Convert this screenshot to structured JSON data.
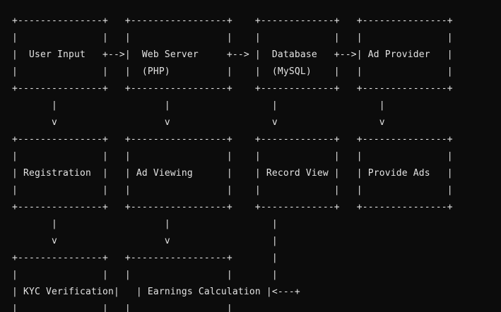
{
  "diagram": {
    "lines": [
      "+---------------+   +-----------------+    +-------------+   +---------------+",
      "|               |   |                 |    |             |   |               |",
      "|  User Input   +-->|  Web Server     +--> |  Database   +-->| Ad Provider   |",
      "|               |   |  (PHP)          |    |  (MySQL)    |   |               |",
      "+---------------+   +-----------------+    +-------------+   +---------------+",
      "       |                   |                  |                  |",
      "       v                   v                  v                  v",
      "+---------------+   +-----------------+    +-------------+   +---------------+",
      "|               |   |                 |    |             |   |               |",
      "| Registration  |   | Ad Viewing      |    | Record View |   | Provide Ads   |",
      "|               |   |                 |    |             |   |               |",
      "+---------------+   +-----------------+    +-------------+   +---------------+",
      "       |                   |                  |",
      "       v                   v                  |",
      "+---------------+   +-----------------+       |",
      "|               |   |                 |       |",
      "| KYC Verification|   | Earnings Calculation |<---+",
      "|               |   |                 |"
    ]
  }
}
